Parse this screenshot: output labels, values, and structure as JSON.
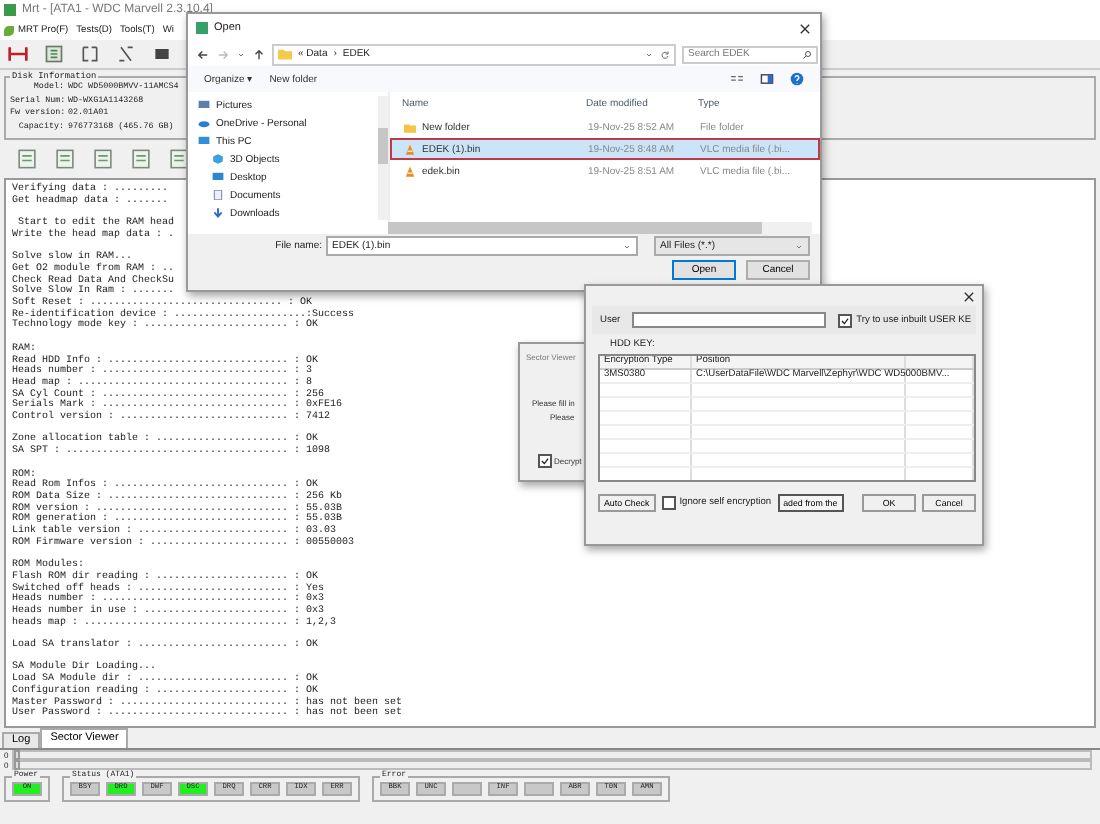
{
  "window": {
    "title": "Mrt - [ATA1 - WDC Marvell 2.3.10.4]"
  },
  "menu": [
    "MRT Pro(F)",
    "Tests(D)",
    "Tools(T)",
    "Wi"
  ],
  "disk_info": {
    "title": "Disk Information",
    "fields": [
      {
        "label": "Model:",
        "value": "WDC WD5000BMVV-11AMCS4"
      },
      {
        "label": "Serial Num:",
        "value": "WD-WXG1A1143268"
      },
      {
        "label": "Fw version:",
        "value": "02.01A01"
      },
      {
        "label": "Capacity:",
        "value": "976773168 (465.76 GB)"
      }
    ]
  },
  "log": [
    [
      "Verifying data : .........",
      "Get headmap data : ......."
    ],
    [
      " Start to edit the RAM head",
      "Write the head map data : ."
    ],
    [
      "Solve slow in RAM...",
      "Get O2 module from RAM : ..",
      "Check Read Data And CheckSu",
      "Solve Slow In Ram : .......",
      "Soft Reset : ................................ : OK",
      "Re-identification device : ......................:Success",
      "Technology mode key : ........................ : OK"
    ],
    [
      "RAM:",
      "Read HDD Info : .............................. : OK",
      "Heads number : ............................... : 3",
      "Head map : ................................... : 8",
      "SA Cyl Count : ............................... : 256",
      "Serials Mark : ............................... : 0xFE16",
      "Control version : ............................ : 7412"
    ],
    [
      "Zone allocation table : ...................... : OK",
      "SA SPT : ..................................... : 1098"
    ],
    [
      "ROM:",
      "Read Rom Infos : ............................. : OK",
      "ROM Data Size : .............................. : 256 Kb",
      "ROM version : ................................ : 55.03B",
      "ROM generation : ............................. : 55.03B",
      "Link table version : ......................... : 03.03",
      "ROM Firmware version : ....................... : 00550003"
    ],
    [
      "ROM Modules:",
      "Flash ROM dir reading : ...................... : OK",
      "Switched off heads : ......................... : Yes",
      "Heads number : ............................... : 0x3",
      "Heads number in use : ........................ : 0x3",
      "heads map : .................................. : 1,2,3"
    ],
    [
      "Load SA translator : ......................... : OK"
    ],
    [
      "SA Module Dir Loading...",
      "Load SA Module dir : ......................... : OK",
      "Configuration reading : ...................... : OK",
      "Master Password : ............................ : has not been set",
      "User Password : .............................. : has not been set"
    ]
  ],
  "tabs": [
    {
      "label": "Log",
      "selected": false
    },
    {
      "label": "Sector Viewer",
      "selected": true
    }
  ],
  "sliders": [
    {
      "label": "0",
      "level": 0
    },
    {
      "label": "0",
      "level": 0
    }
  ],
  "status_groups": [
    {
      "title": "Power",
      "lights": [
        {
          "label": "ON",
          "on": true
        }
      ]
    },
    {
      "title": "Status (ATA1)",
      "lights": [
        {
          "label": "BSY",
          "on": false
        },
        {
          "label": "DRD",
          "on": true
        },
        {
          "label": "DWF",
          "on": false
        },
        {
          "label": "DSC",
          "on": true
        },
        {
          "label": "DRQ",
          "on": false
        },
        {
          "label": "CRR",
          "on": false
        },
        {
          "label": "IDX",
          "on": false
        },
        {
          "label": "ERR",
          "on": false
        }
      ]
    },
    {
      "title": "Error",
      "lights": [
        {
          "label": "BBK",
          "on": false
        },
        {
          "label": "UNC",
          "on": false
        },
        {
          "on": false
        },
        {
          "label": "INF",
          "on": false
        },
        {
          "on": false
        },
        {
          "label": "ABR",
          "on": false
        },
        {
          "label": "T0N",
          "on": false
        },
        {
          "label": "AMN",
          "on": false
        }
      ]
    }
  ],
  "open_dialog": {
    "title": "Open",
    "path": [
      "« Data",
      "›",
      "EDEK"
    ],
    "search": {
      "placeholder": "Search EDEK"
    },
    "commands": [
      "Organize ▾",
      "New folder"
    ],
    "nav": [
      {
        "label": "Pictures",
        "kind": "pictures"
      },
      {
        "label": "OneDrive - Personal",
        "kind": "cloud"
      },
      {
        "label": "This PC",
        "kind": "pc"
      },
      {
        "label": "3D Objects",
        "kind": "objects"
      },
      {
        "label": "Desktop",
        "kind": "desktop"
      },
      {
        "label": "Documents",
        "kind": "documents"
      },
      {
        "label": "Downloads",
        "kind": "downloads"
      }
    ],
    "columns": [
      "Name",
      "Date modified",
      "Type"
    ],
    "files": [
      {
        "name": "New folder",
        "date": "19-Nov-25 8:52 AM",
        "type": "File folder",
        "kind": "folder",
        "selected": false
      },
      {
        "name": "EDEK (1).bin",
        "date": "19-Nov-25 8:48 AM",
        "type": "VLC media file (.bi...",
        "kind": "media",
        "selected": true
      },
      {
        "name": "edek.bin",
        "date": "19-Nov-25 8:51 AM",
        "type": "VLC media file (.bi...",
        "kind": "media",
        "selected": false
      }
    ],
    "file_name_label": "File name:",
    "file_name": "EDEK (1).bin",
    "filter": "All Files (*.*)",
    "buttons": [
      "Open",
      "Cancel"
    ]
  },
  "sector_viewer": {
    "title": "Sector Viewer",
    "lines": [
      "Please fill in",
      "Please"
    ],
    "decrypt": {
      "label": "Decrypt",
      "checked": true
    }
  },
  "key_dialog": {
    "user_label": "User",
    "inbuilt": {
      "label": "Try to use inbuilt USER KE",
      "checked": true
    },
    "hdd_key_label": "HDD KEY:",
    "columns": [
      "Encryption Type",
      "Position"
    ],
    "rows": [
      [
        "3MS0380",
        "C:\\UserDataFile\\WDC Marvell\\Zephyr\\WDC WD5000BMV..."
      ]
    ],
    "buttons": [
      "Auto Check",
      "aded from the",
      "OK",
      "Cancel"
    ],
    "ignore": {
      "label": "Ignore self encryption",
      "checked": false
    }
  }
}
